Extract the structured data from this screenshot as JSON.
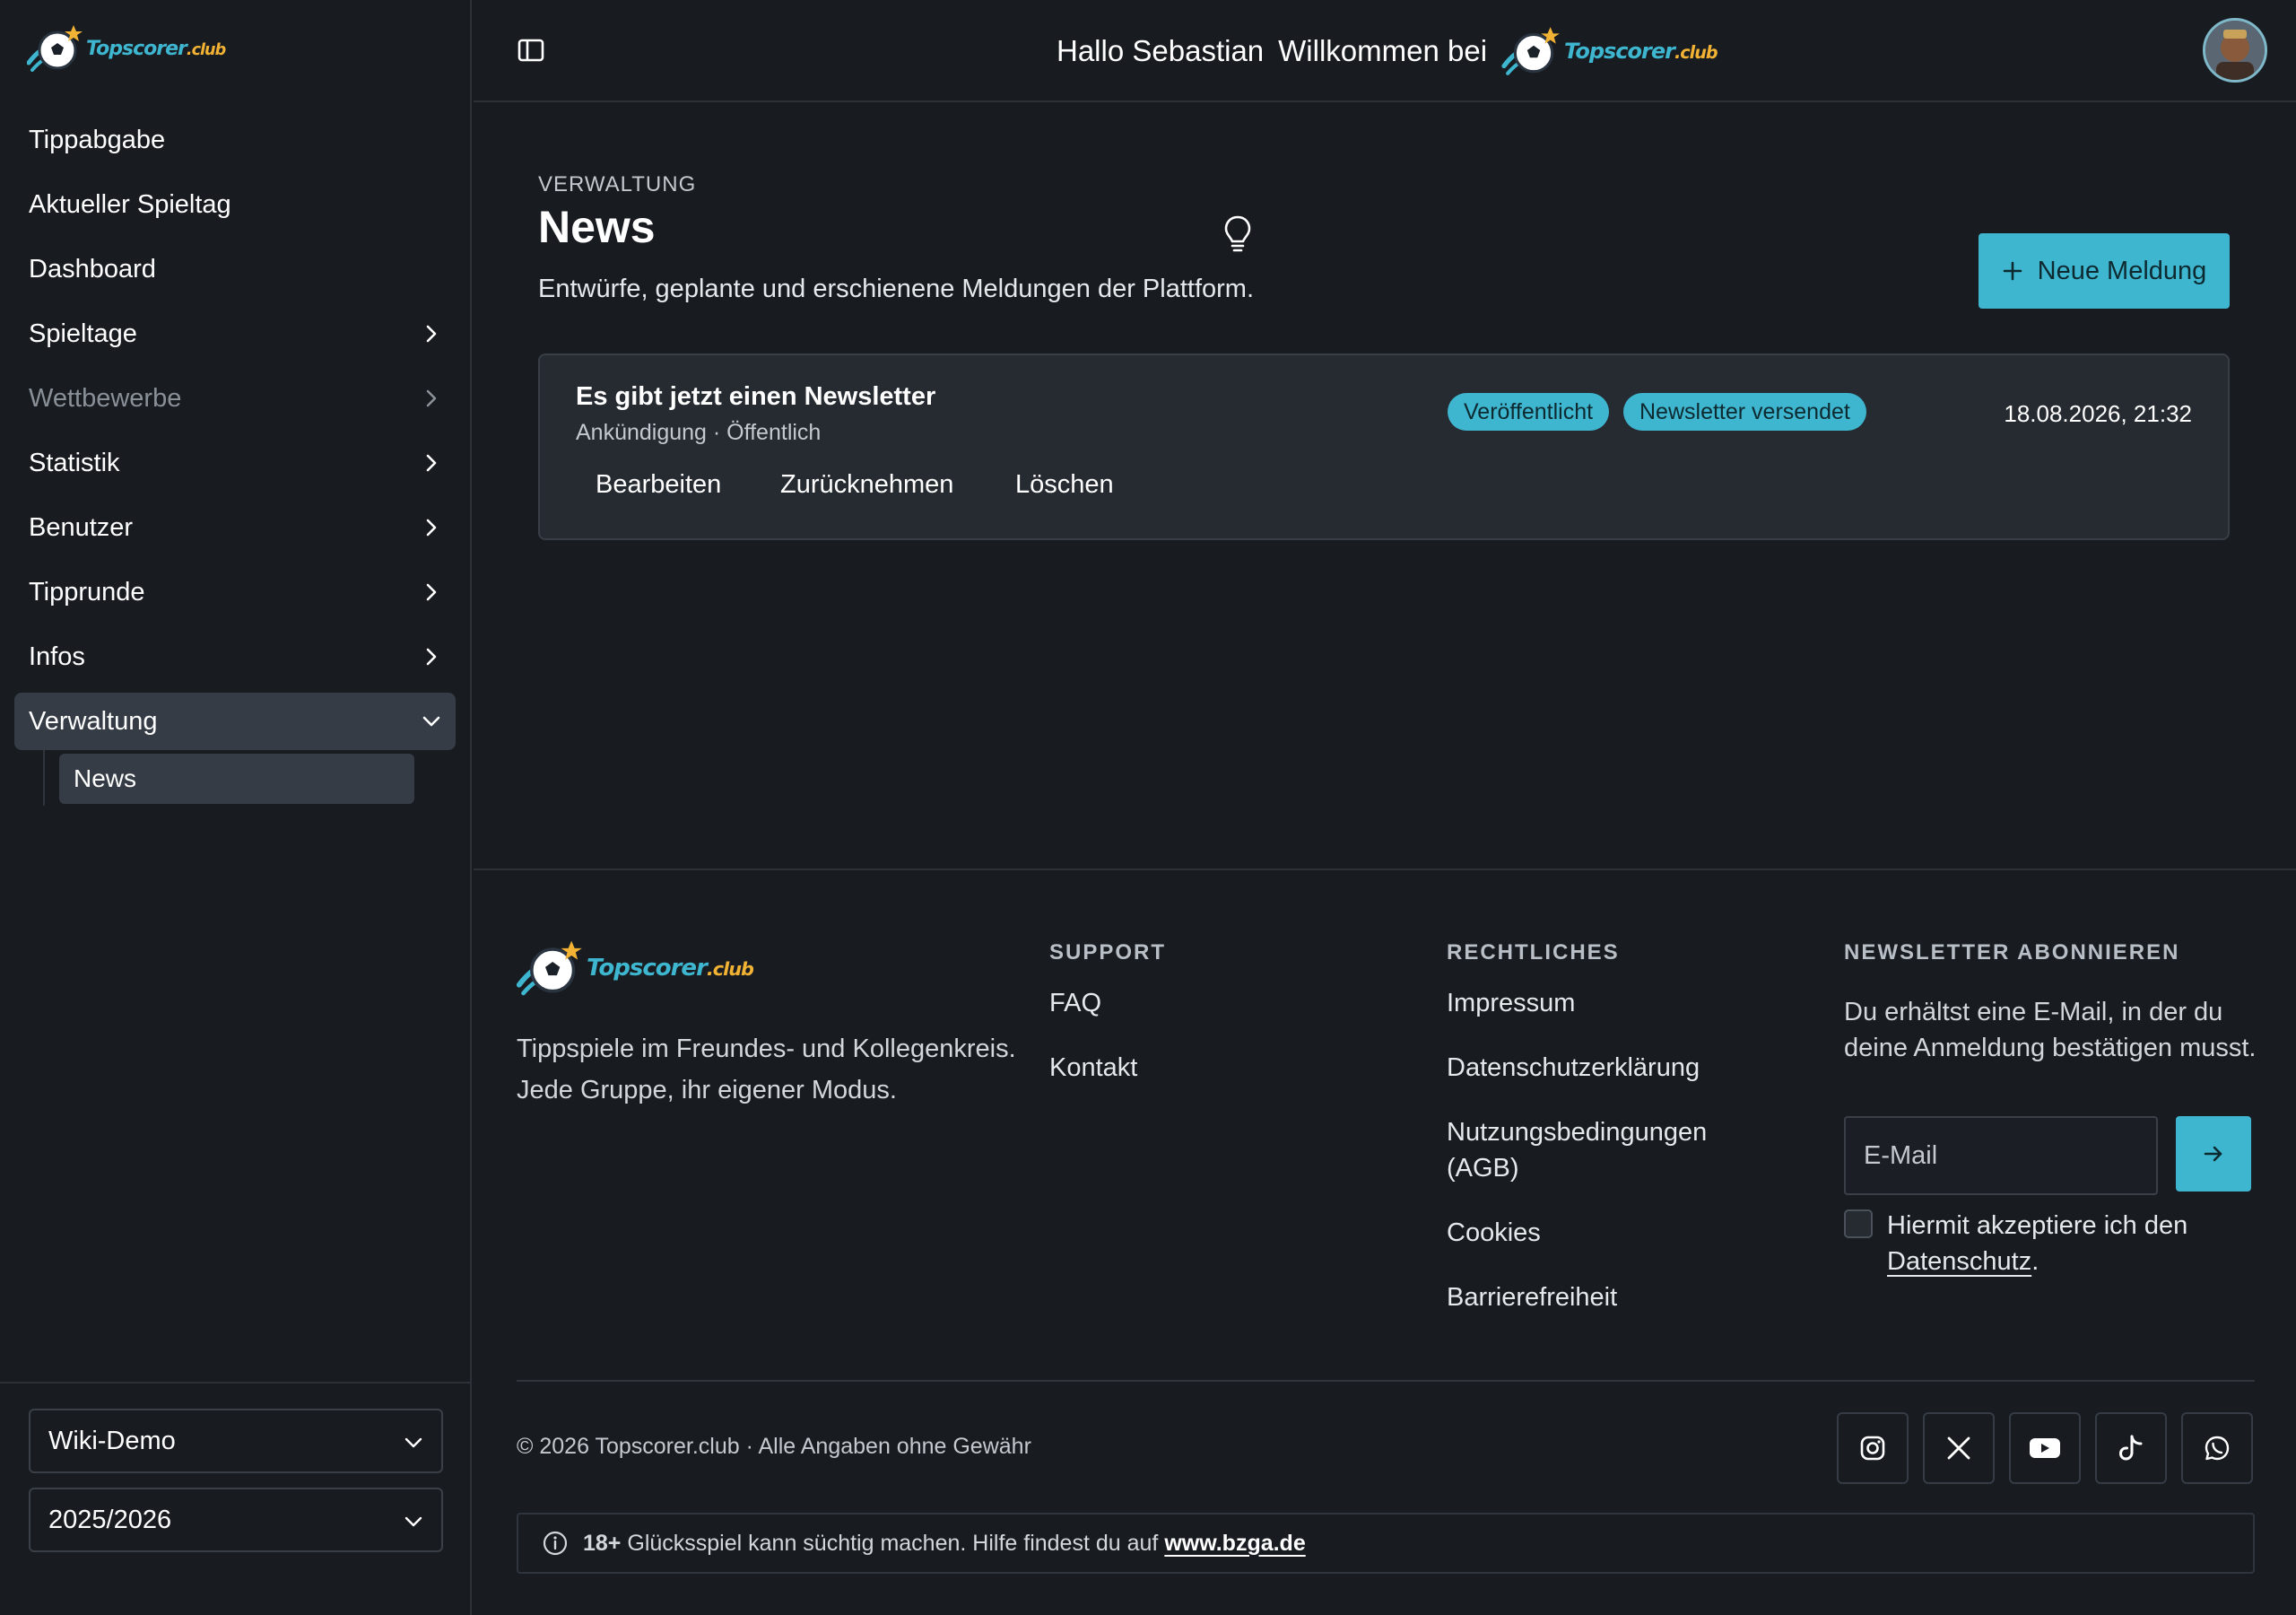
{
  "brand": {
    "name": "Topscorer",
    "suffix": ".club"
  },
  "colors": {
    "accent": "#3eb6cf",
    "star": "#f2b233",
    "background": "#181c21",
    "card": "#262b32"
  },
  "header": {
    "greeting": "Hallo Sebastian",
    "welcome": "Willkommen bei"
  },
  "sidebar": {
    "items": [
      {
        "label": "Tippabgabe"
      },
      {
        "label": "Aktueller Spieltag"
      },
      {
        "label": "Dashboard"
      },
      {
        "label": "Spieltage"
      },
      {
        "label": "Wettbewerbe"
      },
      {
        "label": "Statistik"
      },
      {
        "label": "Benutzer"
      },
      {
        "label": "Tipprunde"
      },
      {
        "label": "Infos"
      },
      {
        "label": "Verwaltung"
      }
    ],
    "sub_item": "News",
    "group_select": "Wiki-Demo",
    "season_select": "2025/2026"
  },
  "page": {
    "eyebrow": "VERWALTUNG",
    "title": "News",
    "subtitle": "Entwürfe, geplante und erschienene Meldungen der Plattform.",
    "new_button": "Neue Meldung"
  },
  "news": [
    {
      "title": "Es gibt jetzt einen Newsletter",
      "meta": "Ankündigung · Öffentlich",
      "badges": [
        "Veröffentlicht",
        "Newsletter versendet"
      ],
      "date": "18.08.2026, 21:32",
      "actions": [
        "Bearbeiten",
        "Zurücknehmen",
        "Löschen"
      ]
    }
  ],
  "footer": {
    "description": "Tippspiele im Freundes- und Kollegenkreis. Jede Gruppe, ihr eigener Modus.",
    "support": {
      "heading": "SUPPORT",
      "links": [
        "FAQ",
        "Kontakt"
      ]
    },
    "legal": {
      "heading": "RECHTLICHES",
      "links": [
        "Impressum",
        "Datenschutzerklärung",
        "Nutzungsbedingungen (AGB)",
        "Cookies",
        "Barrierefreiheit"
      ]
    },
    "newsletter": {
      "heading": "NEWSLETTER ABONNIEREN",
      "text": "Du erhältst eine E-Mail, in der du deine Anmeldung bestätigen musst.",
      "placeholder": "E-Mail",
      "consent_prefix": "Hiermit akzeptiere ich den",
      "consent_link": "Datenschutz",
      "consent_suffix": "."
    },
    "copyright": "© 2026 Topscorer.club · Alle Angaben ohne Gewähr",
    "social": [
      "instagram-icon",
      "x-icon",
      "youtube-icon",
      "tiktok-icon",
      "whatsapp-icon"
    ],
    "warning": {
      "bold": "18+",
      "text": "Glücksspiel kann süchtig machen. Hilfe findest du auf",
      "link": "www.bzga.de"
    }
  }
}
